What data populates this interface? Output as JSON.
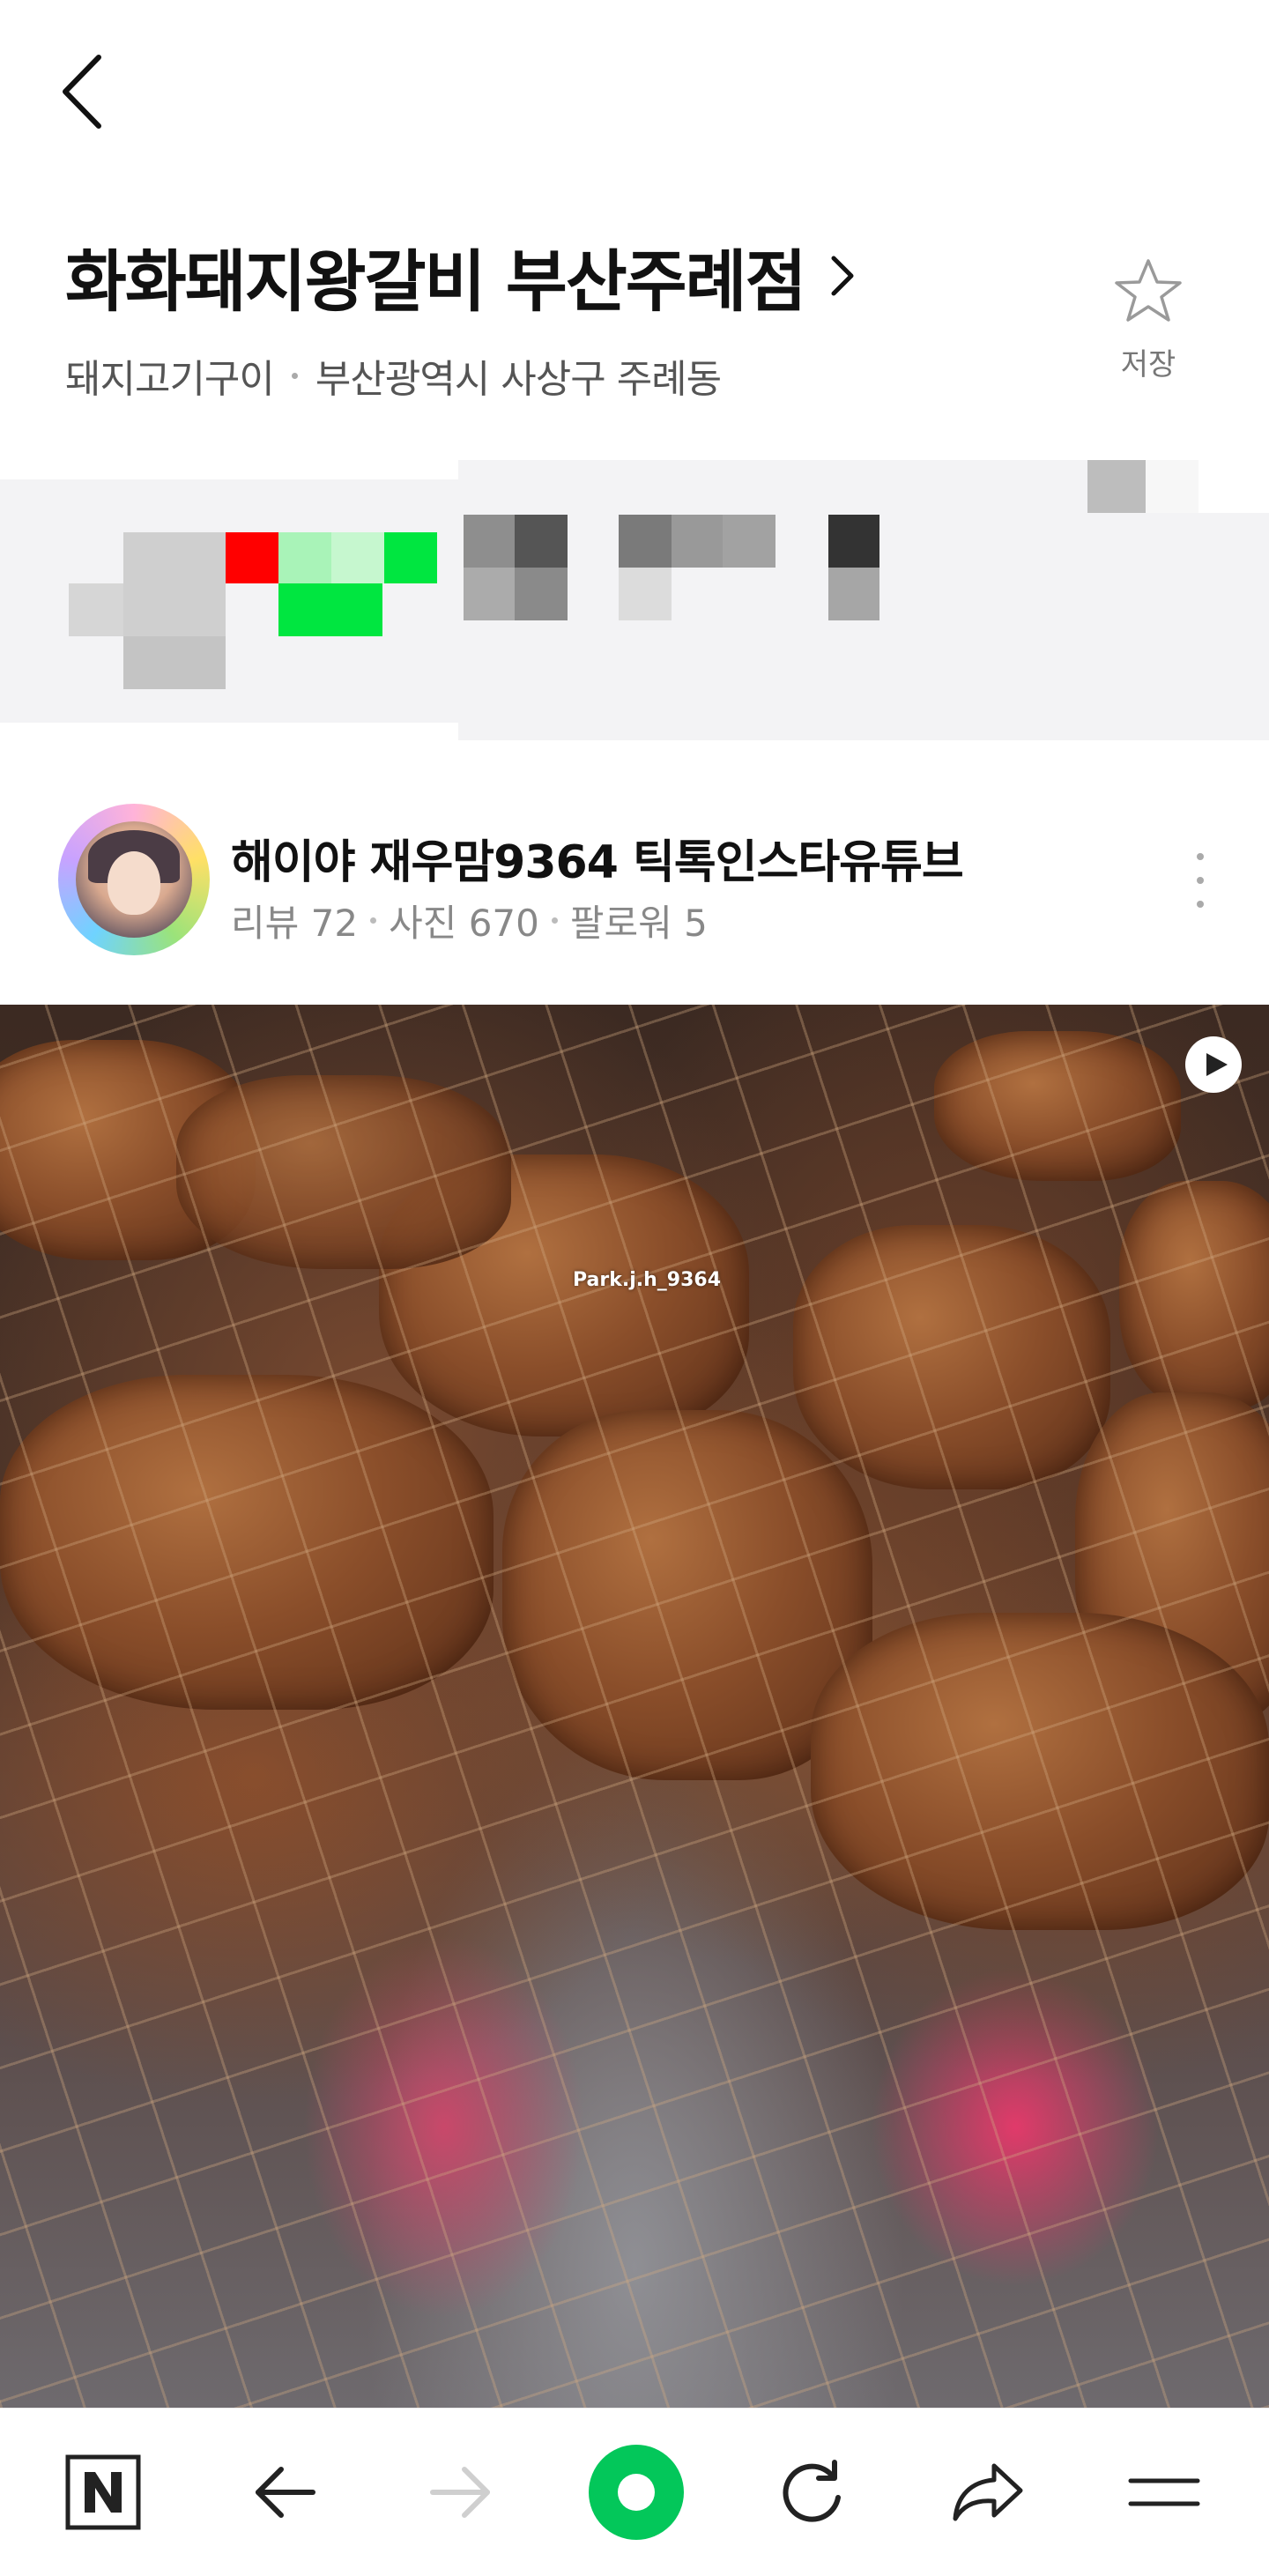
{
  "header": {
    "back_icon": "chevron-left-icon"
  },
  "place": {
    "name": "화화돼지왕갈비 부산주례점",
    "category": "돼지고기구이",
    "address": "부산광역시 사상구 주례동",
    "save_label": "저장"
  },
  "reviewer": {
    "name": "해이야 재우맘9364 틱톡인스타유튜브",
    "reviews": "리뷰 72",
    "photos": "사진 670",
    "followers": "팔로워 5"
  },
  "photo": {
    "watermark": "Park.j.h_9364",
    "play_icon": "play-icon"
  },
  "bottom_bar": {
    "items": [
      "naver-home-icon",
      "back-arrow-icon",
      "forward-arrow-icon",
      "green-dot-icon",
      "refresh-icon",
      "share-icon",
      "menu-icon"
    ]
  },
  "colors": {
    "green_accent": "#03c75a",
    "disabled_gray": "#cfcfcf",
    "pixel_red": "#ff0000",
    "pixel_green": "#00e640"
  }
}
